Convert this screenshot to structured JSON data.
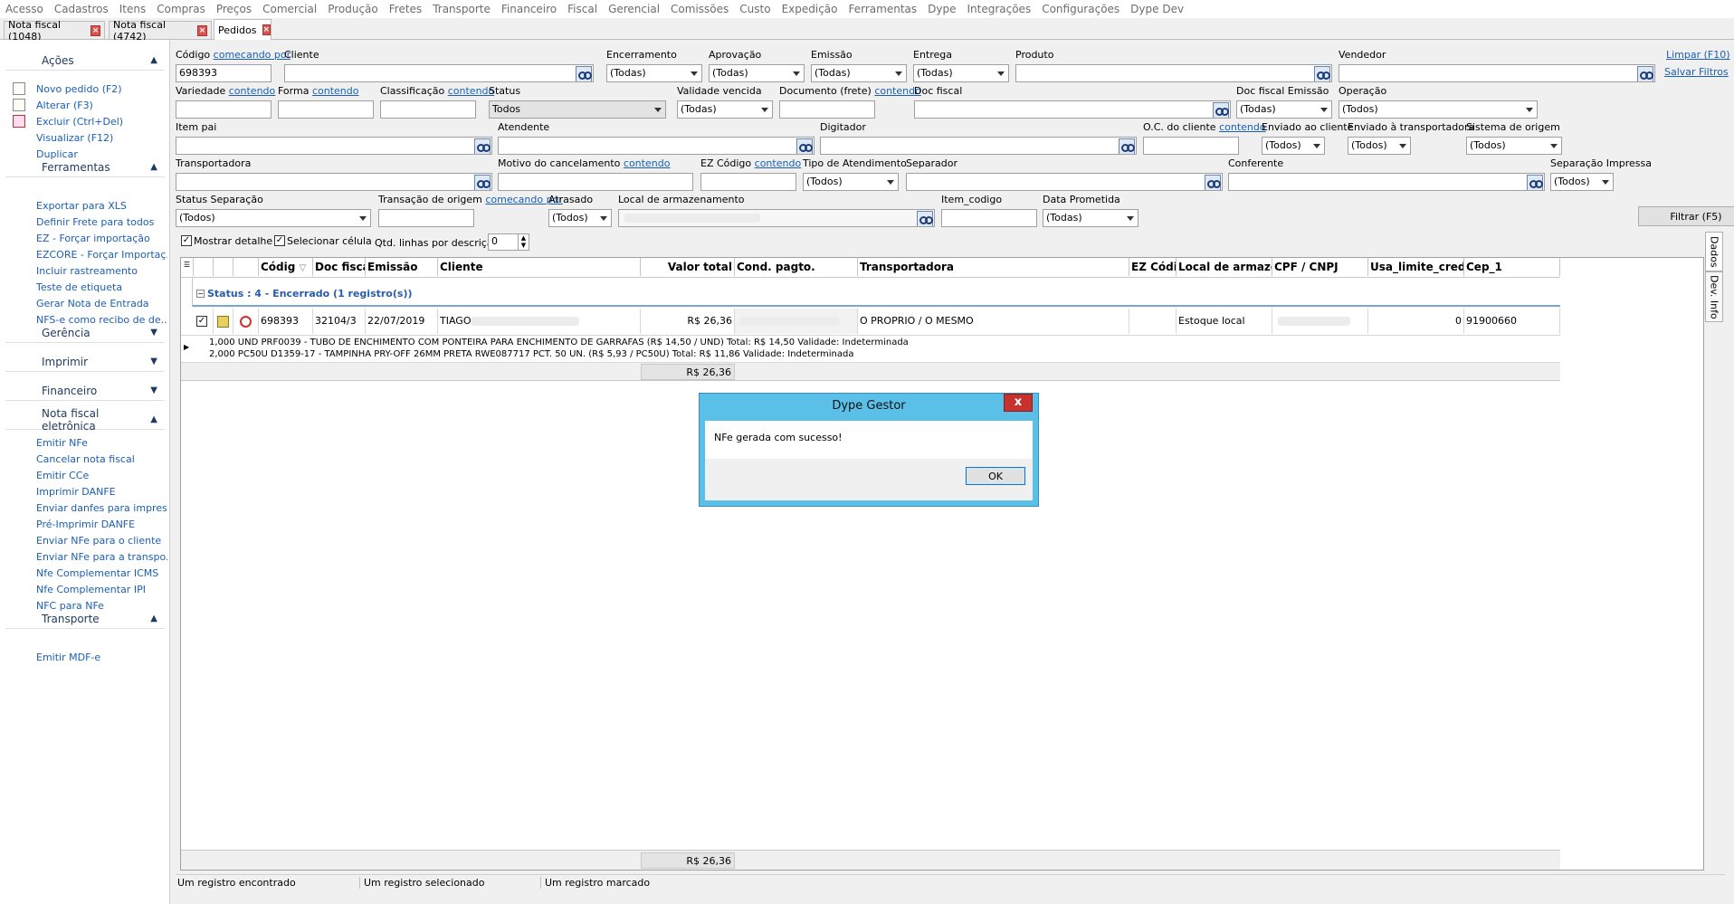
{
  "menu": [
    "Acesso",
    "Cadastros",
    "Itens",
    "Compras",
    "Preços",
    "Comercial",
    "Produção",
    "Fretes",
    "Transporte",
    "Financeiro",
    "Fiscal",
    "Gerencial",
    "Comissões",
    "Custo",
    "Expedição",
    "Ferramentas",
    "Dype",
    "Integrações",
    "Configurações",
    "Dype Dev"
  ],
  "tabs": [
    {
      "label": "Nota fiscal (1048)"
    },
    {
      "label": "Nota fiscal (4742)"
    },
    {
      "label": "Pedidos"
    }
  ],
  "sidebar": {
    "acoes": {
      "title": "Ações",
      "items": [
        "Novo pedido (F2)",
        "Alterar (F3)",
        "Excluir (Ctrl+Del)",
        "Visualizar (F12)",
        "Duplicar"
      ]
    },
    "ferramentas": {
      "title": "Ferramentas",
      "items": [
        "Exportar para XLS",
        "Definir Frete para todos",
        "EZ - Forçar importação",
        "EZCORE - Forçar Importaç...",
        "Incluir rastreamento",
        "Teste de etiqueta",
        "Gerar Nota de Entrada",
        "NFS-e como recibo de de..."
      ]
    },
    "gerencia": {
      "title": "Gerência"
    },
    "imprimir": {
      "title": "Imprimir"
    },
    "financeiro": {
      "title": "Financeiro"
    },
    "nfe": {
      "title": "Nota fiscal eletrônica",
      "items": [
        "Emitir NFe",
        "Cancelar nota fiscal",
        "Emitir CCe",
        "Imprimir DANFE",
        "Enviar danfes para impres...",
        "Pré-Imprimir DANFE",
        "Enviar NFe para o cliente",
        "Enviar NFe para a transpo...",
        "Nfe Complementar ICMS",
        "Nfe Complementar IPI",
        "NFC para NFe"
      ]
    },
    "transporte": {
      "title": "Transporte",
      "items": [
        "Emitir MDF-e"
      ]
    }
  },
  "filters": {
    "codigo": {
      "label": "Código",
      "link": "comecando por",
      "value": "698393"
    },
    "cliente": {
      "label": "Cliente"
    },
    "encerramento": {
      "label": "Encerramento",
      "value": "(Todas)"
    },
    "aprovacao": {
      "label": "Aprovação",
      "value": "(Todas)"
    },
    "emissao": {
      "label": "Emissão",
      "value": "(Todas)"
    },
    "entrega": {
      "label": "Entrega",
      "value": "(Todas)"
    },
    "produto": {
      "label": "Produto"
    },
    "vendedor": {
      "label": "Vendedor"
    },
    "limpar": "Limpar (F10)",
    "salvar": "Salvar Filtros",
    "variedade": {
      "label": "Variedade",
      "link": "contendo"
    },
    "forma": {
      "label": "Forma",
      "link": "contendo"
    },
    "classificacao": {
      "label": "Classificação",
      "link": "contendo"
    },
    "status": {
      "label": "Status",
      "value": "Todos"
    },
    "validade": {
      "label": "Validade vencida",
      "value": "(Todas)"
    },
    "documento": {
      "label": "Documento (frete)",
      "link": "contendo"
    },
    "docfiscal": {
      "label": "Doc fiscal"
    },
    "docfiscalemissao": {
      "label": "Doc fiscal Emissão",
      "value": "(Todas)"
    },
    "operacao": {
      "label": "Operação",
      "value": "(Todos)"
    },
    "itempai": {
      "label": "Item pai"
    },
    "atendente": {
      "label": "Atendente"
    },
    "digitador": {
      "label": "Digitador"
    },
    "oc": {
      "label": "O.C. do cliente",
      "link": "contendo"
    },
    "enviadocliente": {
      "label": "Enviado ao cliente",
      "value": "(Todos)"
    },
    "enviadotransp": {
      "label": "Enviado à transportadora",
      "value": "(Todos)"
    },
    "sistemaorigem": {
      "label": "Sistema de origem",
      "value": "(Todos)"
    },
    "transportadora": {
      "label": "Transportadora"
    },
    "motivo": {
      "label": "Motivo do cancelamento",
      "link": "contendo"
    },
    "ezcodigo": {
      "label": "EZ Código",
      "link": "contendo"
    },
    "tipoatend": {
      "label": "Tipo de Atendimento",
      "value": "(Todos)"
    },
    "separador": {
      "label": "Separador"
    },
    "conferente": {
      "label": "Conferente"
    },
    "sepimpressa": {
      "label": "Separação Impressa",
      "value": "(Todos)"
    },
    "statussep": {
      "label": "Status Separação",
      "value": "(Todos)"
    },
    "transorigem": {
      "label": "Transação de origem",
      "link": "comecando por"
    },
    "atrasado": {
      "label": "Atrasado",
      "value": "(Todos)"
    },
    "local": {
      "label": "Local de armazenamento"
    },
    "itemcodigo": {
      "label": "Item_codigo"
    },
    "dataprometida": {
      "label": "Data Prometida",
      "value": "(Todas)"
    },
    "filtrar": "Filtrar (F5)"
  },
  "options": {
    "mostrar": "Mostrar detalhe",
    "selecionar": "Selecionar célula",
    "qtd_label": "Qtd. linhas por descrição",
    "qtd_value": "0"
  },
  "grid": {
    "columns": [
      "Códig",
      "Doc fisca",
      "Emissão",
      "Cliente",
      "Valor total",
      "Cond. pagto.",
      "Transportadora",
      "EZ Códi",
      "Local de armaze",
      "CPF / CNPJ",
      "Usa_limite_cred",
      "Cep_1"
    ],
    "group": "Status : 4 - Encerrado (1 registro(s))",
    "row": {
      "codigo": "698393",
      "doc": "32104/3",
      "emissao": "22/07/2019",
      "cliente": "TIAGO",
      "valor": "R$ 26,36",
      "transportadora": "O PROPRIO / O MESMO",
      "local": "Estoque local",
      "limite": "0",
      "cep": "91900660"
    },
    "details": [
      "1,000 UND PRF0039 - TUBO DE ENCHIMENTO COM PONTEIRA PARA ENCHIMENTO DE GARRAFAS (R$ 14,50 / UND)  Total: R$ 14,50 Validade: Indeterminada",
      "2,000 PC50U D1359-17 - TAMPINHA PRY-OFF 26MM PRETA RWE087717 PCT. 50 UN. (R$ 5,93 / PC50U)  Total: R$ 11,86 Validade: Indeterminada"
    ],
    "group_total": "R$ 26,36",
    "grand_total": "R$ 26,36"
  },
  "right_tabs": [
    "Dados",
    "Dev. Info"
  ],
  "status": [
    "Um registro encontrado",
    "Um registro selecionado",
    "Um registro marcado"
  ],
  "dialog": {
    "title": "Dype Gestor",
    "message": "NFe gerada com sucesso!",
    "ok": "OK",
    "close": "x"
  }
}
